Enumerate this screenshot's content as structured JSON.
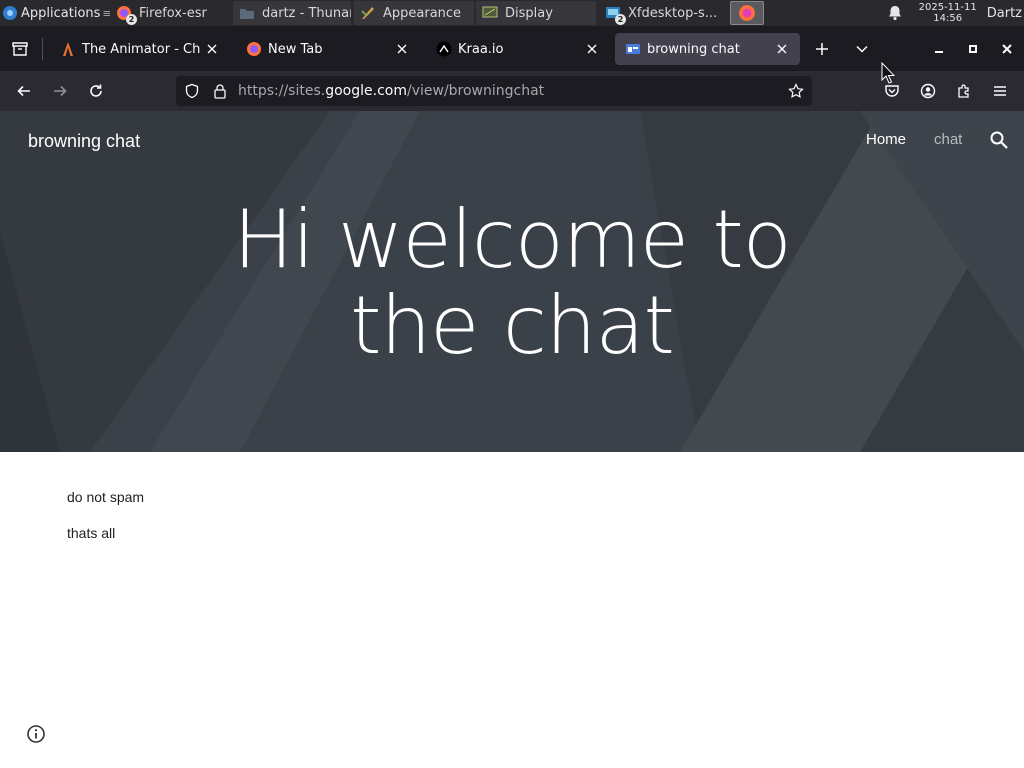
{
  "panel": {
    "applications_label": "Applications",
    "tasks": [
      {
        "label": "Firefox-esr",
        "badge": "2"
      },
      {
        "label": "dartz - Thunar"
      },
      {
        "label": "Appearance"
      },
      {
        "label": "Display"
      },
      {
        "label": "Xfdesktop-s...",
        "badge": "2"
      }
    ],
    "clock_date": "2025-11-11",
    "clock_time": "14:56",
    "user": "Dartz"
  },
  "browser": {
    "tabs": [
      {
        "label": "The Animator - Chr"
      },
      {
        "label": "New Tab"
      },
      {
        "label": "Kraa.io"
      },
      {
        "label": "browning chat"
      }
    ],
    "url_prefix": "https://sites.",
    "url_host": "google.com",
    "url_path": "/view/browningchat"
  },
  "site": {
    "title": "browning chat",
    "nav": [
      {
        "label": "Home"
      },
      {
        "label": "chat"
      }
    ],
    "hero_line1": "Hi welcome to",
    "hero_line2": "the chat",
    "paragraphs": [
      "do not spam",
      "thats all"
    ]
  },
  "colors": {
    "hero_bg": "#3b4148",
    "browser_chrome": "#2b2a33",
    "tab_strip": "#1c1b22",
    "active_tab": "#42414d"
  }
}
